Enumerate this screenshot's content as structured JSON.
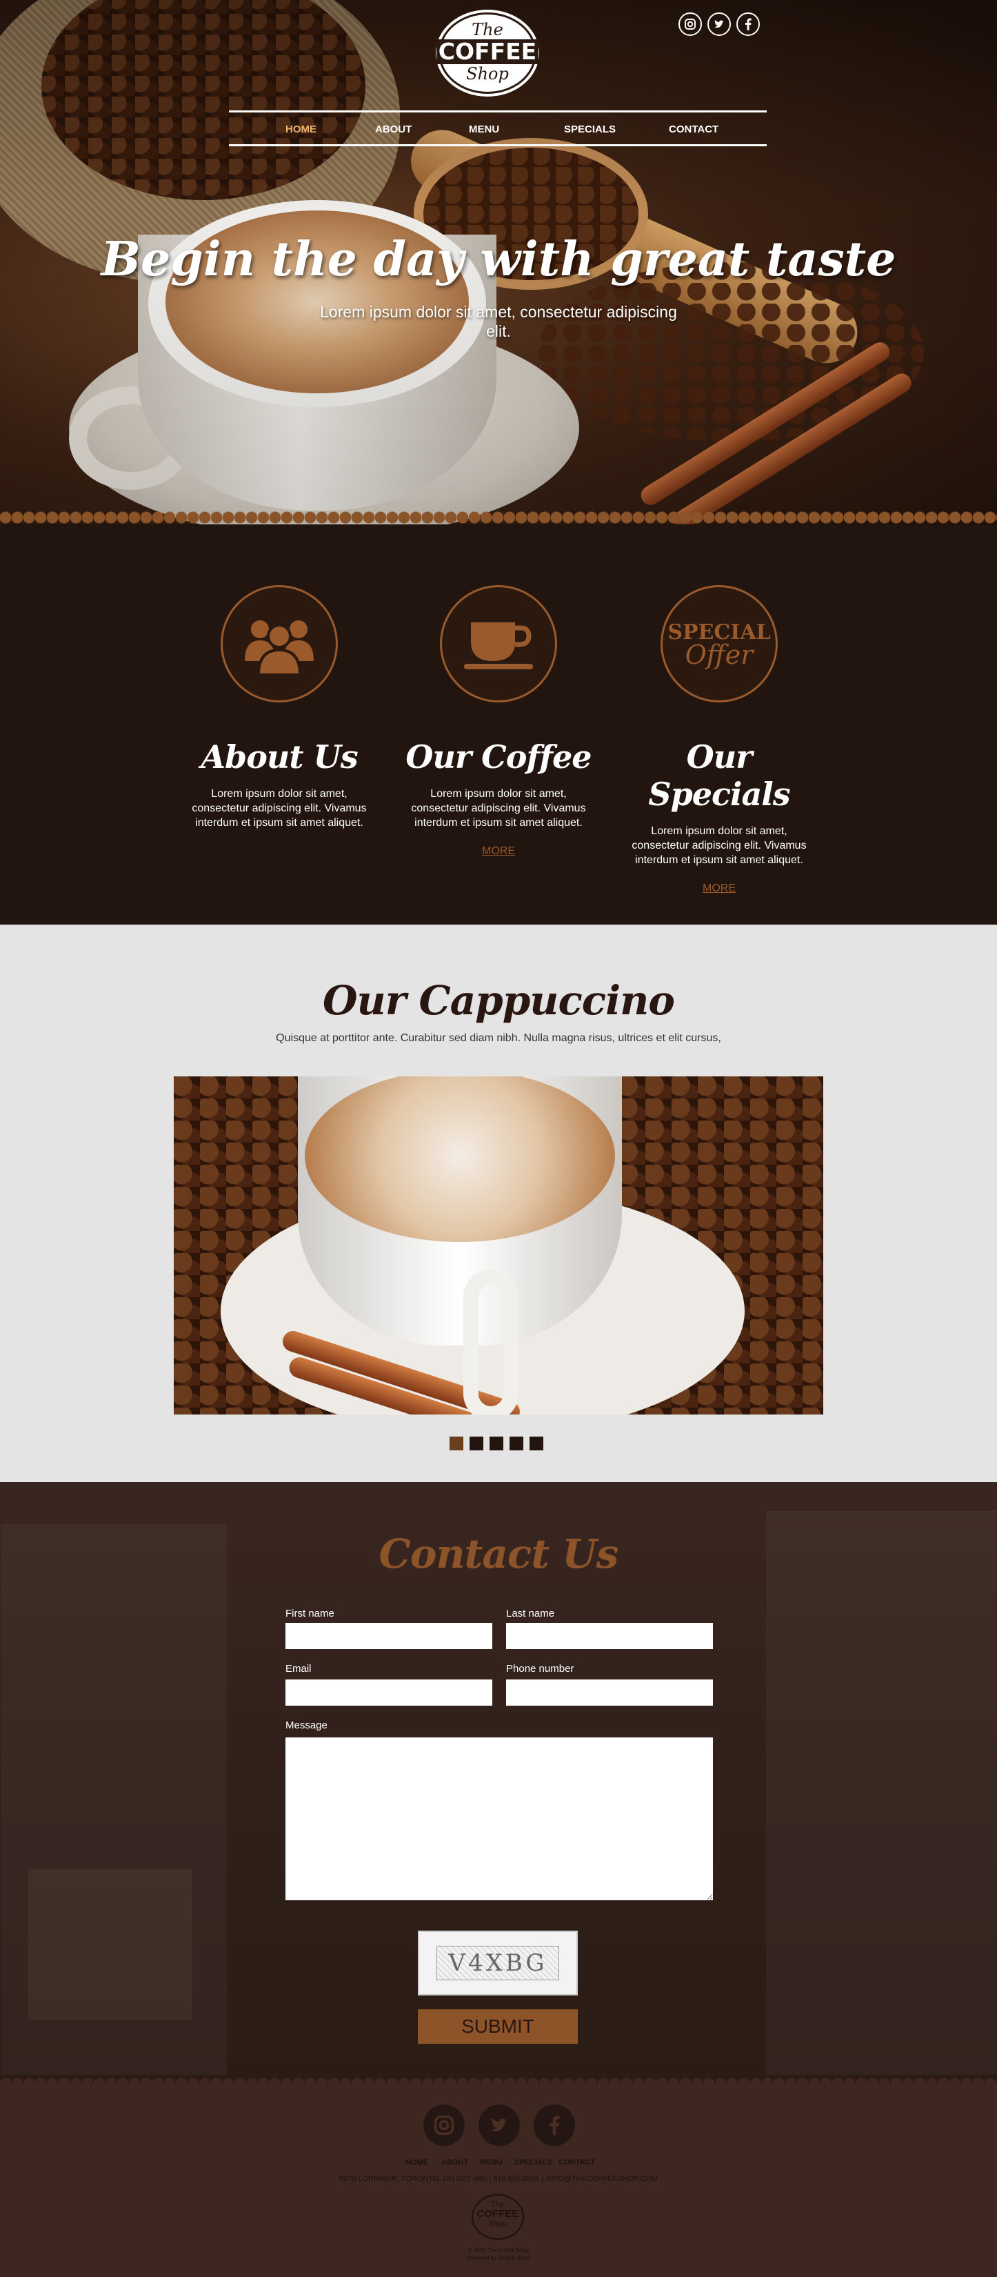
{
  "header": {
    "logo_line1": "The",
    "logo_line2": "COFFEE",
    "logo_line3": "Shop",
    "social": [
      "instagram-icon",
      "twitter-icon",
      "facebook-icon"
    ],
    "nav": [
      "HOME",
      "ABOUT",
      "MENU",
      "SPECIALS",
      "CONTACT"
    ],
    "active_nav": "HOME"
  },
  "hero": {
    "title": "Begin the day with great taste",
    "subtitle": "Lorem ipsum dolor sit amet, consectetur adipiscing elit."
  },
  "features": [
    {
      "icon": "people-icon",
      "title": "About Us",
      "text": "Lorem ipsum dolor sit amet, consectetur adipiscing elit. Vivamus interdum et ipsum sit amet aliquet.",
      "link": ""
    },
    {
      "icon": "coffee-cup-icon",
      "title": "Our Coffee",
      "text": "Lorem ipsum dolor sit amet, consectetur adipiscing elit. Vivamus interdum et ipsum sit amet aliquet.",
      "link": "MORE"
    },
    {
      "icon": "special-offer-icon",
      "icon_text_1": "SPECIAL",
      "icon_text_2": "Offer",
      "title": "Our Specials",
      "text": "Lorem ipsum dolor sit amet, consectetur adipiscing elit. Vivamus interdum et ipsum sit amet aliquet.",
      "link": "MORE"
    }
  ],
  "cappuccino": {
    "title": "Our Cappuccino",
    "description": "Quisque at porttitor ante. Curabitur sed diam nibh. Nulla magna risus, ultrices et elit cursus,",
    "slide_count": 5,
    "active_slide": 1
  },
  "contact": {
    "title": "Contact Us",
    "labels": {
      "first_name": "First name",
      "last_name": "Last name",
      "email": "Email",
      "phone": "Phone number",
      "message": "Message"
    },
    "captcha": "V4XBG",
    "submit": "SUBMIT"
  },
  "footer": {
    "social": [
      "instagram-icon",
      "twitter-icon",
      "facebook-icon"
    ],
    "nav": [
      "HOME",
      "ABOUT",
      "MENU",
      "SPECIALS",
      "CONTACT"
    ],
    "address": "8670 LORRIKER, TORONTO, ON G2T 4R5  |  416.555.5555  |  INFO@THECOFFEESHOP.COM",
    "logo_line1": "The",
    "logo_line2": "COFFEE",
    "logo_line3": "Shop",
    "copyright": "© 2014 The Coffee Shop",
    "powered": "Powered by Wobi/E-Build"
  }
}
